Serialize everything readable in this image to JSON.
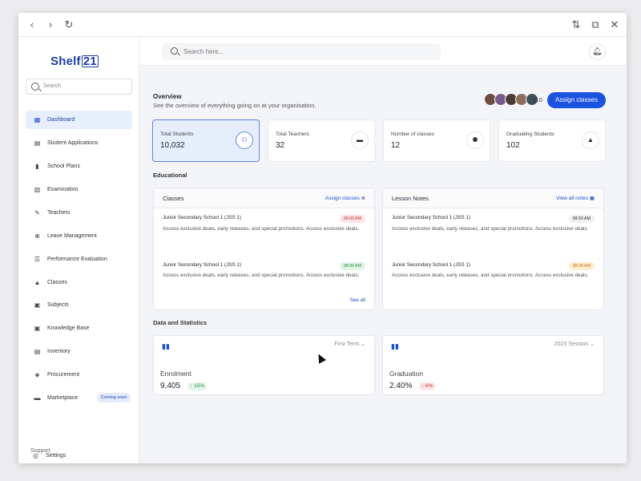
{
  "browser": {
    "back_icon": "chevron-left-icon",
    "forward_icon": "chevron-right-icon",
    "reload_icon": "reload-icon"
  },
  "sidebar": {
    "logo": {
      "text": "Shelf",
      "number": "21"
    },
    "search_placeholder": "Search",
    "items": [
      {
        "label": "Dashboard",
        "icon": "dashboard-icon",
        "active": true
      },
      {
        "label": "Student Applications",
        "icon": "applications-icon"
      },
      {
        "label": "School Plans",
        "icon": "chart-icon"
      },
      {
        "label": "Examination",
        "icon": "exam-icon"
      },
      {
        "label": "Teachers",
        "icon": "teacher-icon"
      },
      {
        "label": "Leave Management",
        "icon": "leave-icon"
      },
      {
        "label": "Performance Evaluation",
        "icon": "list-icon"
      },
      {
        "label": "Classes",
        "icon": "classes-icon"
      },
      {
        "label": "Subjects",
        "icon": "book-icon"
      },
      {
        "label": "Knowledge Base",
        "icon": "knowledge-icon"
      },
      {
        "label": "Inventory",
        "icon": "inventory-icon"
      },
      {
        "label": "Procurement",
        "icon": "procurement-icon"
      },
      {
        "label": "Marketplace",
        "icon": "marketplace-icon",
        "badge": "Coming soon"
      }
    ],
    "support_title": "Support",
    "settings_label": "Settings"
  },
  "topbar": {
    "search_placeholder": "Search here...",
    "bell_icon": "bell-icon"
  },
  "overview": {
    "title": "Overview",
    "subtitle": "See the overview of everything going on at your organisation.",
    "more_count": "+10",
    "assign_button": "Assign classes"
  },
  "stats": [
    {
      "label": "Total Students",
      "value": "10,032",
      "icon": "students-icon",
      "active": true
    },
    {
      "label": "Total Teachers",
      "value": "32",
      "icon": "folder-icon"
    },
    {
      "label": "Number of classes",
      "value": "12",
      "icon": "group-icon"
    },
    {
      "label": "Graduating Students",
      "value": "102",
      "icon": "graduation-cap-icon"
    }
  ],
  "educational": {
    "title": "Educational",
    "classes": {
      "title": "Classes",
      "link": "Assign classes",
      "entries": [
        {
          "title": "Junior Secondary School 1 (JSS 1)",
          "time": "08:00 AM",
          "text": "Access exclusive deals, early releases, and special promotions. Access exclusive deals."
        },
        {
          "title": "Junior Secondary School 1 (JSS 1)",
          "time": "08:00 AM",
          "text": "Access exclusive deals, early releases, and special promotions. Access exclusive deals."
        }
      ],
      "see_all": "See all"
    },
    "lesson_notes": {
      "title": "Lesson Notes",
      "link": "View all notes",
      "entries": [
        {
          "title": "Junior Secondary School 1 (JSS 1)",
          "time": "08:00 AM",
          "text": "Access exclusive deals, early releases, and special promotions. Access exclusive deals."
        },
        {
          "title": "Junior Secondary School 1 (JSS 1)",
          "time": "08:00 AM",
          "text": "Access exclusive deals, early releases, and special promotions. Access exclusive deals."
        }
      ]
    }
  },
  "data_stats": {
    "title": "Data and Statistics",
    "enrolment": {
      "select": "First Term",
      "label": "Enrolment",
      "value": "9,405",
      "change": "↑ 15%"
    },
    "graduation": {
      "select": "2023 Session",
      "label": "Graduation",
      "value": "2.40%",
      "change": "↓ 6%"
    }
  },
  "colors": {
    "accent": "#1a53e0",
    "active_bg": "#e6eefb",
    "up": "#2e8b4a",
    "down": "#c0392b"
  }
}
